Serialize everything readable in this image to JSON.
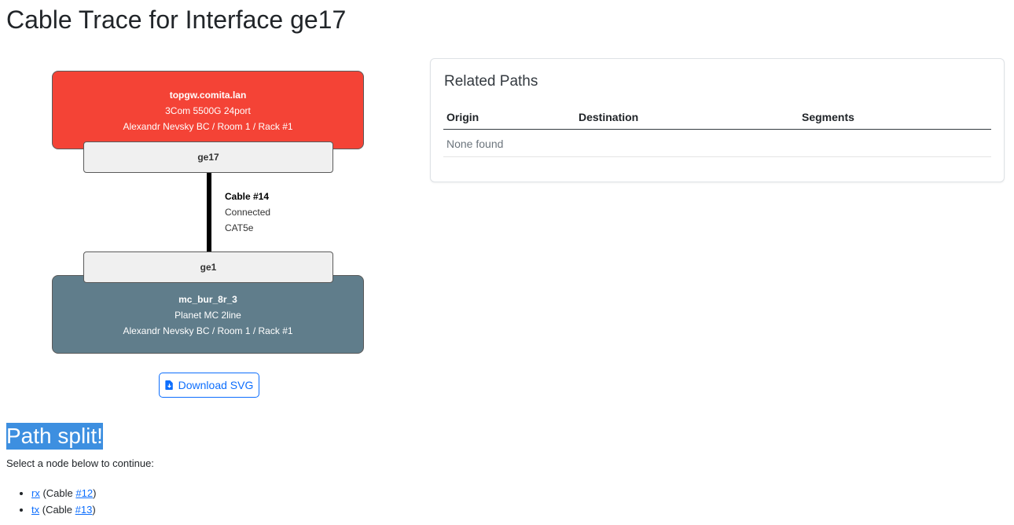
{
  "page": {
    "title": "Cable Trace for Interface ge17"
  },
  "trace": {
    "top_device": {
      "name": "topgw.comita.lan",
      "model": "3Com 5500G 24port",
      "location": "Alexandr Nevsky BC / Room 1 / Rack #1",
      "color": "#f44336"
    },
    "top_interface": "ge17",
    "cable": {
      "name": "Cable #14",
      "status": "Connected",
      "type": "CAT5e",
      "color": "#000000"
    },
    "bottom_interface": "ge1",
    "bottom_device": {
      "name": "mc_bur_8r_3",
      "model": "Planet MC 2line",
      "location": "Alexandr Nevsky BC / Room 1 / Rack #1",
      "color": "#607d8b"
    },
    "download_label": "Download SVG"
  },
  "related": {
    "title": "Related Paths",
    "columns": [
      "Origin",
      "Destination",
      "Segments"
    ],
    "empty_text": "None found"
  },
  "split": {
    "heading": "Path split!",
    "instruction": "Select a node below to continue:",
    "nodes": [
      {
        "link": "rx",
        "prefix": " (Cable ",
        "cable_link": "#12",
        "suffix": ")"
      },
      {
        "link": "tx",
        "prefix": " (Cable ",
        "cable_link": "#13",
        "suffix": ")"
      }
    ]
  },
  "colors": {
    "accent": "#0d6efd",
    "highlight": "#3d8fe0"
  }
}
